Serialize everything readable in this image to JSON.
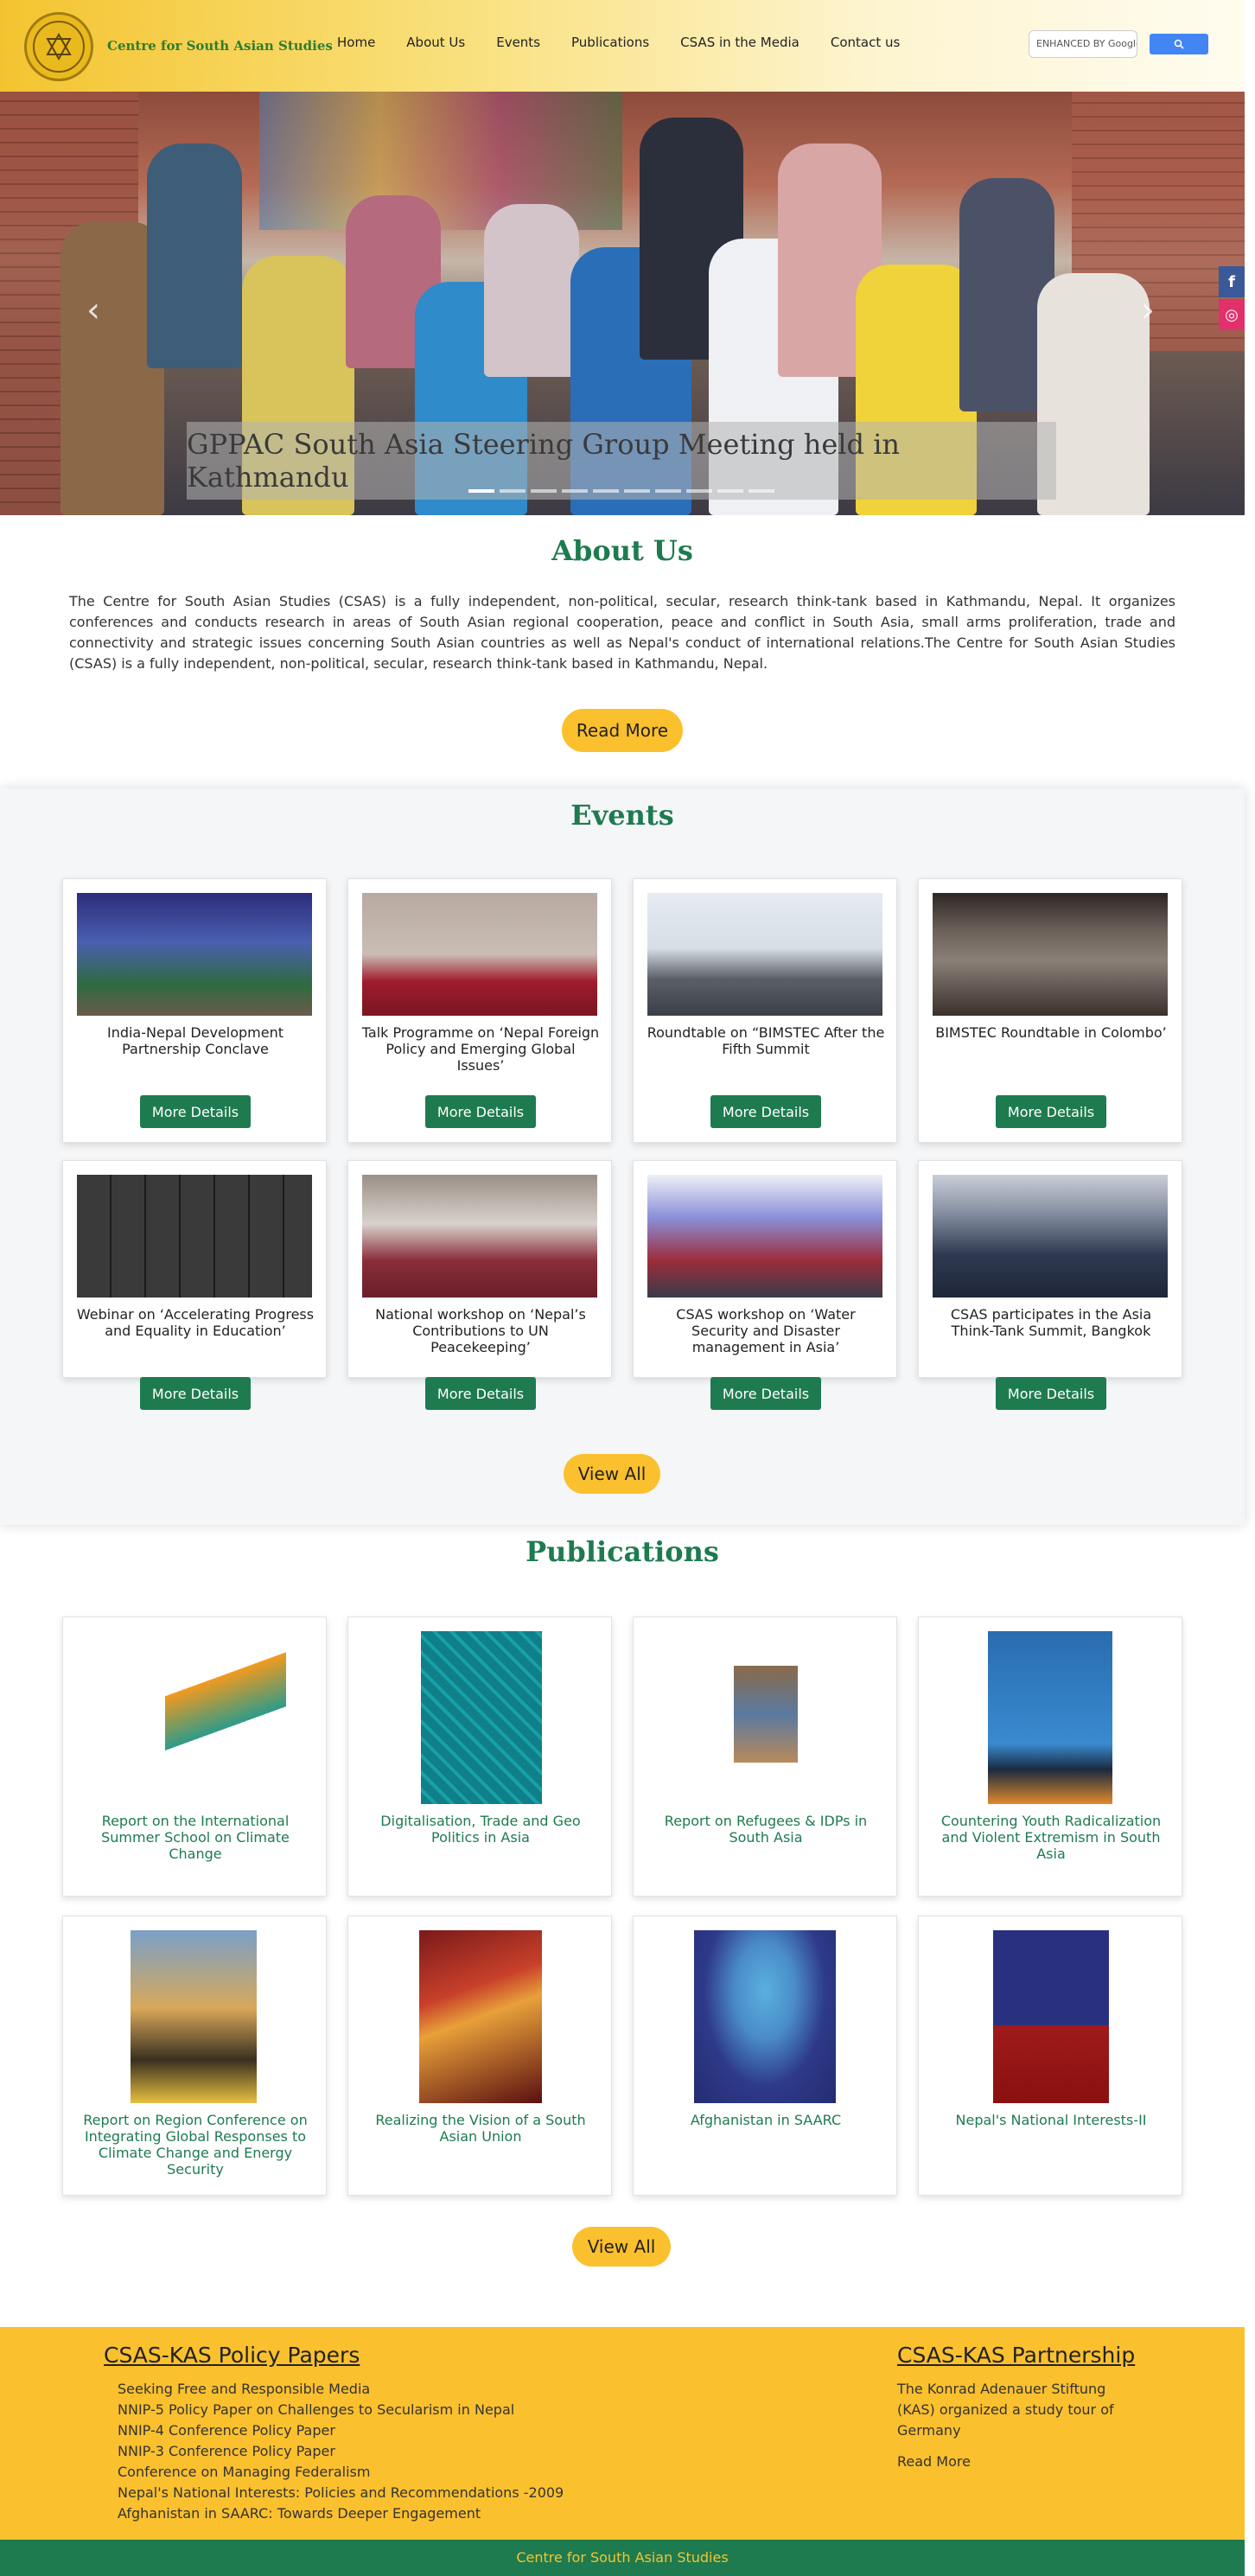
{
  "brand": {
    "name": "Centre for South Asian Studies"
  },
  "nav": [
    "Home",
    "About Us",
    "Events",
    "Publications",
    "CSAS in the Media",
    "Contact us"
  ],
  "search": {
    "placeholder": "ENHANCED BY Google"
  },
  "hero": {
    "caption": "GPPAC South Asia Steering Group Meeting held in Kathmandu",
    "slide_count": 10,
    "active_slide": 1
  },
  "social": {
    "facebook": "f",
    "instagram": "◎"
  },
  "about": {
    "title": "About Us",
    "text": "The Centre for South Asian Studies (CSAS) is a fully independent, non-political, secular, research think-tank based in Kathmandu, Nepal. It organizes conferences and conducts research in areas of South Asian regional cooperation, peace and conflict in South Asia, small arms proliferation, trade and connectivity and strategic issues concerning South Asian countries as well as Nepal's conduct of international relations.The Centre for South Asian Studies (CSAS) is a fully independent, non-political, secular, research think-tank based in Kathmandu, Nepal.",
    "read_more": "Read More"
  },
  "events": {
    "title": "Events",
    "button": "More Details",
    "view_all": "View All",
    "items": [
      {
        "title": "India-Nepal Development Partnership Conclave"
      },
      {
        "title": "Talk Programme on ‘Nepal Foreign Policy and Emerging Global Issues’"
      },
      {
        "title": "Roundtable on “BIMSTEC After the Fifth Summit"
      },
      {
        "title": "BIMSTEC Roundtable in Colombo’"
      },
      {
        "title": "Webinar on ‘Accelerating Progress and Equality in Education’"
      },
      {
        "title": "National workshop on ‘Nepal’s Contributions to UN Peacekeeping’"
      },
      {
        "title": "CSAS workshop on ‘Water Security and Disaster management in Asia’"
      },
      {
        "title": "CSAS participates in the Asia Think-Tank Summit, Bangkok"
      }
    ]
  },
  "publications": {
    "title": "Publications",
    "view_all": "View All",
    "items": [
      {
        "title": "Report on the International Summer School on Climate Change"
      },
      {
        "title": "Digitalisation, Trade and Geo Politics in Asia"
      },
      {
        "title": "Report on Refugees & IDPs in South Asia"
      },
      {
        "title": "Countering Youth Radicalization and Violent Extremism in South Asia"
      },
      {
        "title": "Report on Region Conference on Integrating Global Responses to Climate Change and Energy Security"
      },
      {
        "title": "Realizing the Vision of a South Asian Union"
      },
      {
        "title": "Afghanistan in SAARC"
      },
      {
        "title": "Nepal's National Interests-II"
      }
    ]
  },
  "footer": {
    "policy_title": "CSAS-KAS Policy Papers",
    "policy_items": [
      "Seeking Free and Responsible Media",
      "NNIP-5 Policy Paper on Challenges to Secularism in Nepal",
      "NNIP-4 Conference Policy Paper",
      "NNIP-3 Conference Policy Paper",
      "Conference on Managing Federalism",
      "Nepal's National Interests: Policies and Recommendations -2009",
      "Afghanistan in SAARC: Towards Deeper Engagement"
    ],
    "partner_title": "CSAS-KAS Partnership",
    "partner_text": "The Konrad Adenauer Stiftung (KAS) organized a study tour of Germany",
    "partner_link": "Read More",
    "bottom": "Centre for South Asian Studies"
  }
}
